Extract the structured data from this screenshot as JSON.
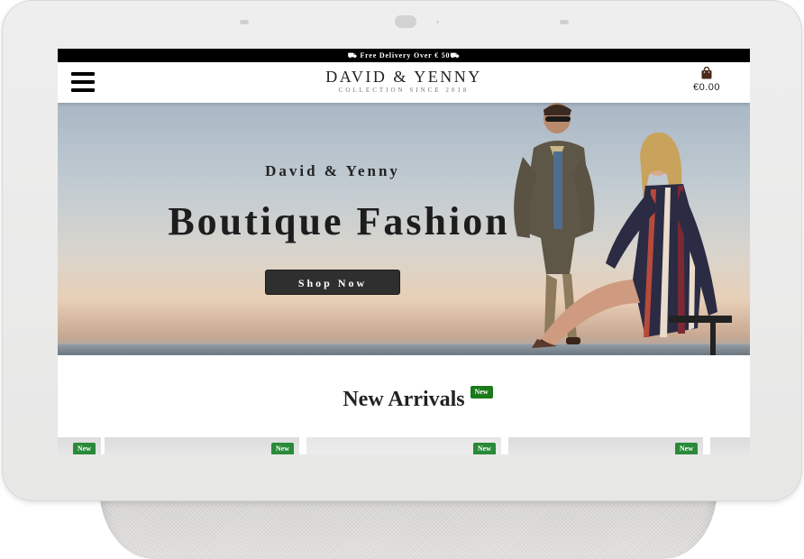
{
  "promo": {
    "text": "Free Delivery Over € 50",
    "icon": "truck-icon"
  },
  "header": {
    "brand_name": "DAVID & YENNY",
    "brand_tagline": "COLLECTION SINCE 2018",
    "cart_total": "€0.00",
    "menu_icon": "hamburger-icon",
    "cart_icon": "shopping-bag-icon"
  },
  "hero": {
    "subtitle": "David & Yenny",
    "title": "Boutique Fashion",
    "cta_label": "Shop Now"
  },
  "arrivals": {
    "title": "New Arrivals",
    "badge": "New",
    "products": [
      {
        "badge": "New"
      },
      {
        "badge": "New"
      },
      {
        "badge": "New"
      },
      {
        "badge": "New"
      }
    ]
  },
  "colors": {
    "promo_bg": "#000000",
    "badge_green": "#1a7a1a",
    "button_bg": "#2f2f2f"
  }
}
